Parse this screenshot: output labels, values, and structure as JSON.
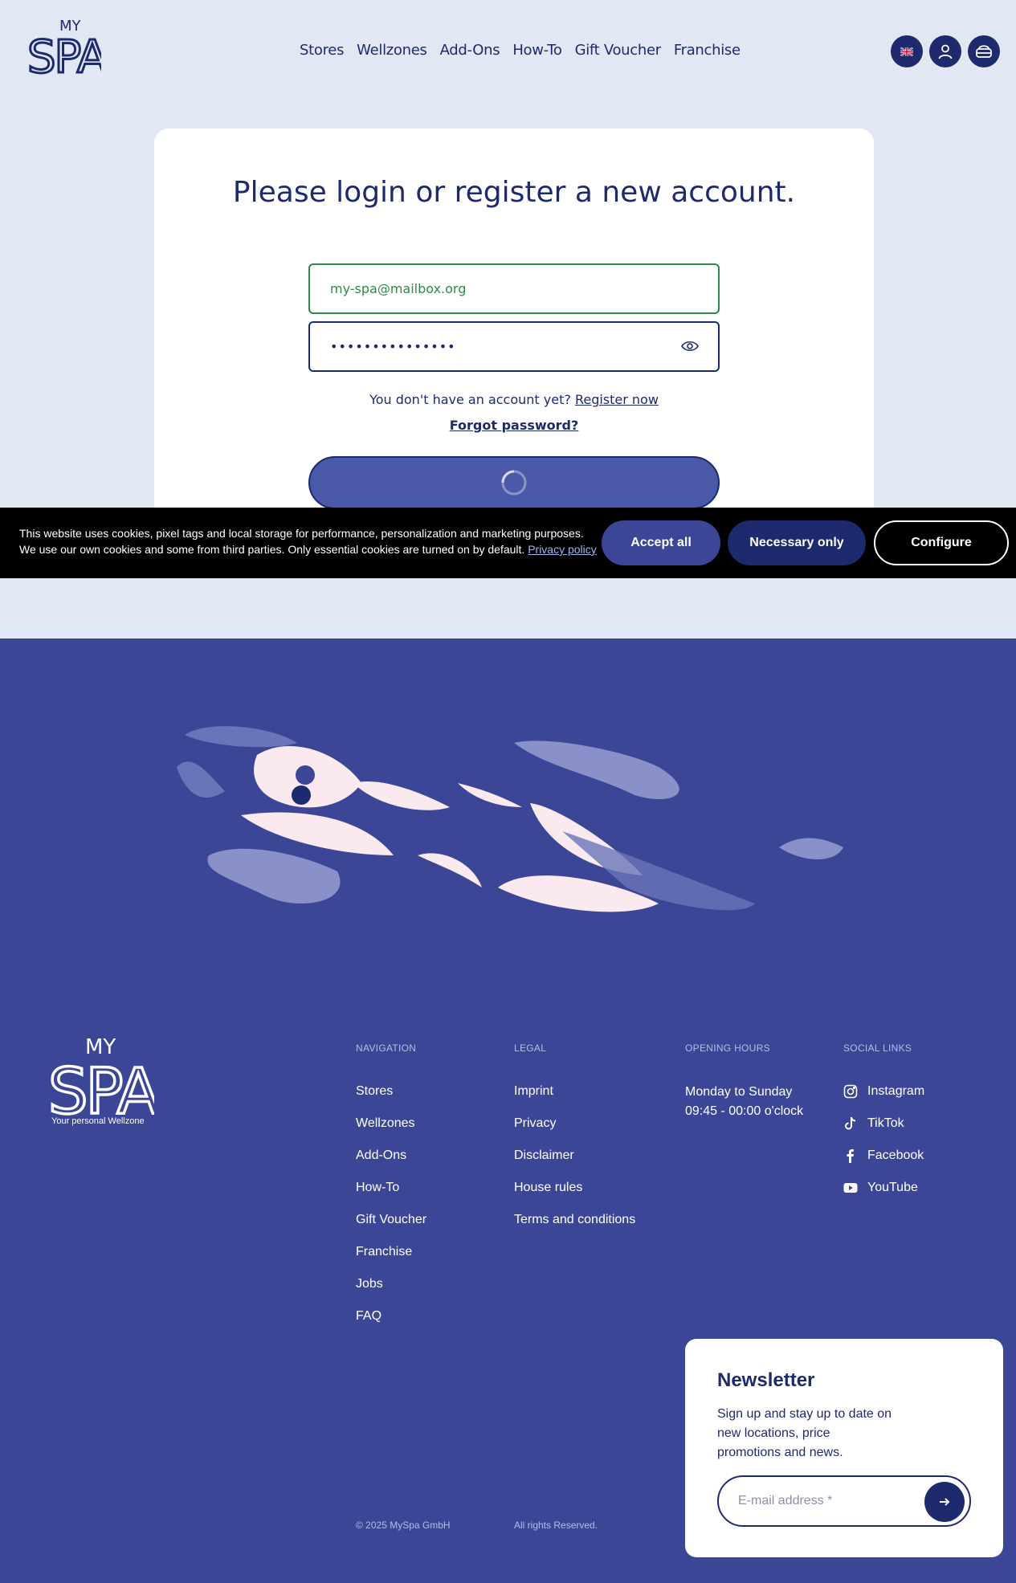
{
  "header": {
    "logo_text": "MY SPA",
    "nav": [
      "Stores",
      "Wellzones",
      "Add-Ons",
      "How-To",
      "Gift Voucher",
      "Franchise"
    ],
    "icons": [
      "uk-flag-icon",
      "user-icon",
      "cart-icon"
    ]
  },
  "login": {
    "title": "Please login or register a new account.",
    "email_value": "my-spa@mailbox.org",
    "password_value": "•••••••••••••••",
    "no_account_text": "You don't have an account yet?",
    "register_link": "Register now",
    "forgot_link": "Forgot password?"
  },
  "cookie": {
    "text": "This website uses cookies, pixel tags and local storage for performance, personalization and marketing purposes. We use our own cookies and some from third parties. Only essential cookies are turned on by default.",
    "privacy_link": "Privacy policy",
    "accept_label": "Accept all",
    "necessary_label": "Necessary only",
    "configure_label": "Configure"
  },
  "footer": {
    "logo_sub": "Your personal Wellzone",
    "nav_heading": "NAVIGATION",
    "nav_links": [
      "Stores",
      "Wellzones",
      "Add-Ons",
      "How-To",
      "Gift Voucher",
      "Franchise",
      "Jobs",
      "FAQ"
    ],
    "legal_heading": "LEGAL",
    "legal_links": [
      "Imprint",
      "Privacy",
      "Disclaimer",
      "House rules",
      "Terms and conditions"
    ],
    "hours_heading": "OPENING HOURS",
    "hours_line1": "Monday to Sunday",
    "hours_line2": "09:45 - 00:00 o'clock",
    "social_heading": "SOCIAL LINKS",
    "social_links": [
      "Instagram",
      "TikTok",
      "Facebook",
      "YouTube"
    ],
    "copyright": "© 2025 MySpa GmbH",
    "rights": "All rights Reserved."
  },
  "newsletter": {
    "title": "Newsletter",
    "text": "Sign up and stay up to date on new locations, price promotions and news.",
    "placeholder": "E-mail address *"
  },
  "colors": {
    "primary": "#1e2a6e",
    "page_bg": "#e2e8f3",
    "footer_bg": "#3c4697",
    "success": "#2e8a4a"
  }
}
